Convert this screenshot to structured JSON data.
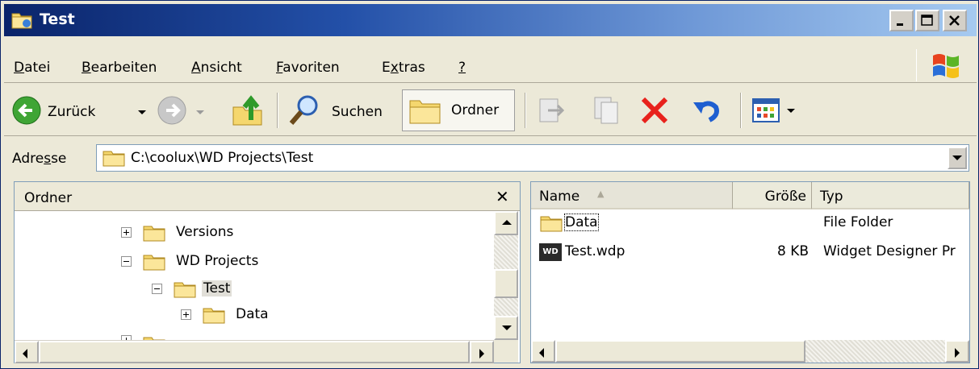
{
  "window": {
    "title": "Test"
  },
  "menu": {
    "items": [
      {
        "pre": "",
        "key": "D",
        "post": "atei"
      },
      {
        "pre": "",
        "key": "B",
        "post": "earbeiten"
      },
      {
        "pre": "",
        "key": "A",
        "post": "nsicht"
      },
      {
        "pre": "",
        "key": "F",
        "post": "avoriten"
      },
      {
        "pre": "E",
        "key": "x",
        "post": "tras"
      },
      {
        "pre": "",
        "key": "?",
        "post": ""
      }
    ]
  },
  "toolbar": {
    "back_label": "Zurück",
    "search_label": "Suchen",
    "folders_label": "Ordner"
  },
  "address": {
    "label_pre": "Adre",
    "label_key": "s",
    "label_post": "se",
    "path": "C:\\coolux\\WD Projects\\Test"
  },
  "folders_pane": {
    "title": "Ordner",
    "close_symbol": "✕",
    "tree": [
      {
        "label": "Versions",
        "expander": "plus"
      },
      {
        "label": "WD Projects",
        "expander": "minus"
      },
      {
        "label": "Test",
        "expander": "minus",
        "selected": true
      },
      {
        "label": "Data",
        "expander": "plus"
      }
    ]
  },
  "file_list": {
    "columns": {
      "name": "Name",
      "size": "Größe",
      "type": "Typ"
    },
    "sort_indicator": "▲",
    "rows": [
      {
        "name": "Data",
        "size": "",
        "type": "File Folder",
        "icon": "folder-icon"
      },
      {
        "name": "Test.wdp",
        "size": "8 KB",
        "type": "Widget Designer Pr",
        "icon": "wdp-file-icon"
      }
    ],
    "wdp_badge": "WD"
  },
  "colors": {
    "title_start": "#0a246a",
    "title_end": "#a6caf0",
    "chrome": "#ece9d8",
    "folder": "#f5d76e"
  }
}
